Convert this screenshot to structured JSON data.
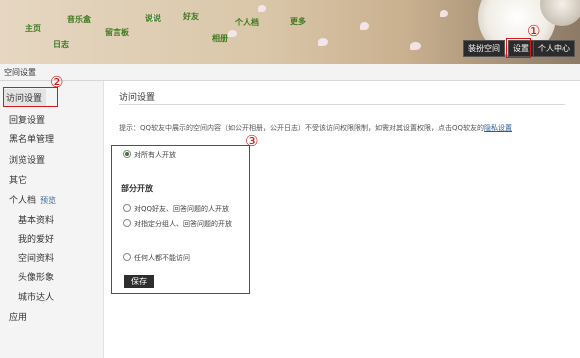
{
  "header": {
    "nav": [
      "主页",
      "音乐盒",
      "说说",
      "好友",
      "个人档",
      "更多",
      "日志",
      "留言板",
      "相册"
    ],
    "buttons": {
      "decorate": "装扮空间",
      "settings": "设置",
      "personal_center": "个人中心"
    }
  },
  "subbar": {
    "title": "空间设置"
  },
  "sidebar": {
    "items": [
      {
        "label": "访问设置"
      },
      {
        "label": "回复设置"
      },
      {
        "label": "黑名单管理"
      },
      {
        "label": "浏览设置"
      },
      {
        "label": "其它"
      },
      {
        "label": "个人档",
        "extra": "预览"
      },
      {
        "label": "基本资料"
      },
      {
        "label": "我的爱好"
      },
      {
        "label": "空间资料"
      },
      {
        "label": "头像形象"
      },
      {
        "label": "城市达人"
      },
      {
        "label": "应用"
      }
    ]
  },
  "main": {
    "title": "访问设置",
    "hint": "提示：QQ软友中展示的空间内容（如公开相册，公开日志）不受该访问权限限制，如需对其设置权限，点击QQ软友的",
    "hint_link": "隐私设置",
    "options": {
      "all": "对所有人开放",
      "partial_label": "部分开放",
      "friends": "对QQ好友、回答问题的人开放",
      "groups": "对指定分组人、回答问题的开放",
      "none": "任何人都不能访问"
    },
    "save": "保存"
  },
  "annotations": {
    "one": "①",
    "two": "②",
    "three": "③"
  },
  "colors": {
    "accent_red": "#d11b1b",
    "nav_green": "#3c7a1e",
    "button_dark": "#2b2b2b"
  }
}
